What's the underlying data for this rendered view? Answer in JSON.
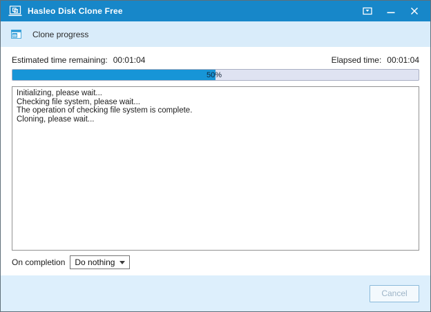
{
  "window": {
    "title": "Hasleo Disk Clone Free"
  },
  "header": {
    "title": "Clone progress"
  },
  "status": {
    "estimated_label": "Estimated time remaining:",
    "estimated_value": "00:01:04",
    "elapsed_label": "Elapsed time:",
    "elapsed_value": "00:01:04"
  },
  "progress": {
    "percent": 50,
    "percent_label": "50%"
  },
  "log": {
    "lines": [
      "Initializing, please wait...",
      "Checking file system, please wait...",
      "The operation of checking file system is complete.",
      "Cloning, please wait..."
    ]
  },
  "completion": {
    "label": "On completion",
    "selected_option": "Do nothing"
  },
  "footer": {
    "cancel_label": "Cancel"
  },
  "colors": {
    "titlebar": "#1787c9",
    "accent": "#1795d7",
    "header_band": "#d9ecfa",
    "footer": "#ddeffc",
    "progress_bg": "#dfe3f2",
    "window_border": "#5f6f7a"
  }
}
